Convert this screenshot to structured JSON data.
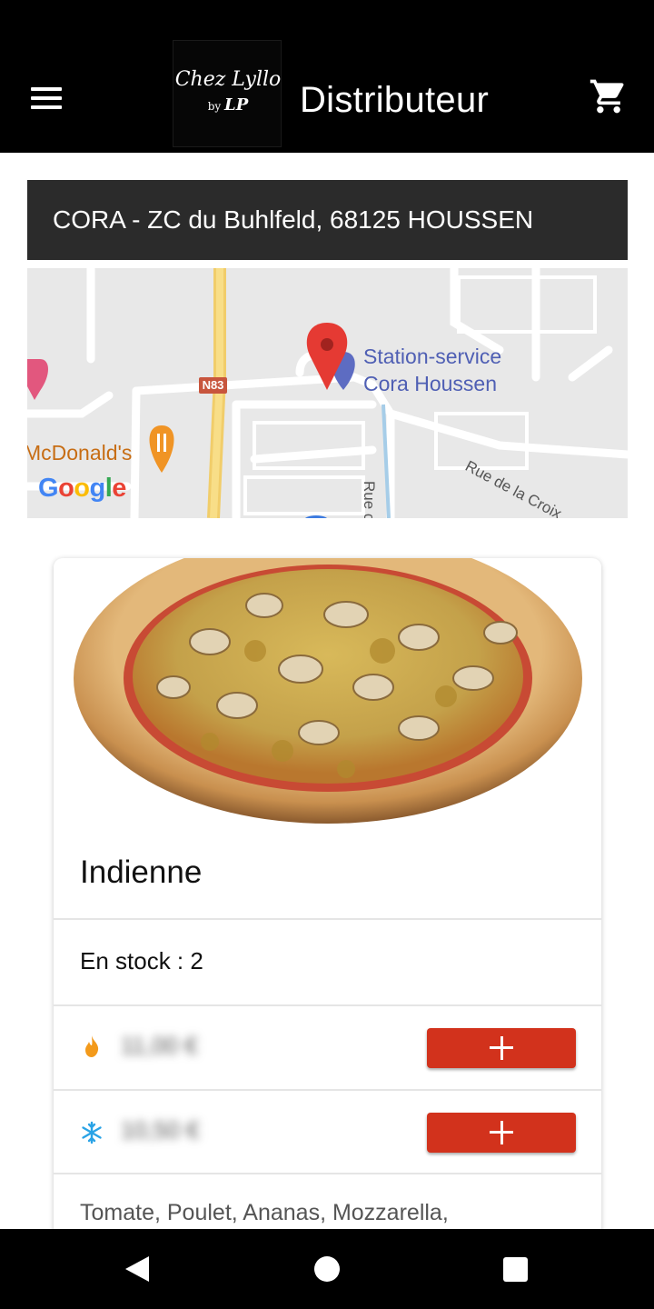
{
  "app_bar": {
    "title": "Distributeur",
    "logo_line1": "Chez Lyllo",
    "logo_by": "by",
    "logo_initials": "LP",
    "icons": {
      "menu": "hamburger-menu-icon",
      "cart": "shopping-cart-icon"
    }
  },
  "location": {
    "address": "CORA - ZC du Buhlfeld, 68125 HOUSSEN"
  },
  "map": {
    "poi_station": "Station-service",
    "poi_station_line2": "Cora Houssen",
    "poi_mcdonalds": "McDonald's",
    "road_badge": "N83",
    "street_name": "Rue de la Croix",
    "street_partial": "Rue d",
    "provider": "Google"
  },
  "product": {
    "name": "Indienne",
    "stock_label": "En stock : 2",
    "prices": [
      {
        "icon": "flame-icon",
        "value": "11,00 €",
        "add_label": "+"
      },
      {
        "icon": "snowflake-icon",
        "value": "10,50 €",
        "add_label": "+"
      }
    ],
    "ingredients": "Tomate, Poulet, Ananas, Mozzarella,"
  },
  "colors": {
    "accent": "#d2321c",
    "app_bar": "#000000",
    "address_bar": "#2b2b2b",
    "flame": "#f39a1b",
    "snowflake": "#2aa3e6"
  }
}
